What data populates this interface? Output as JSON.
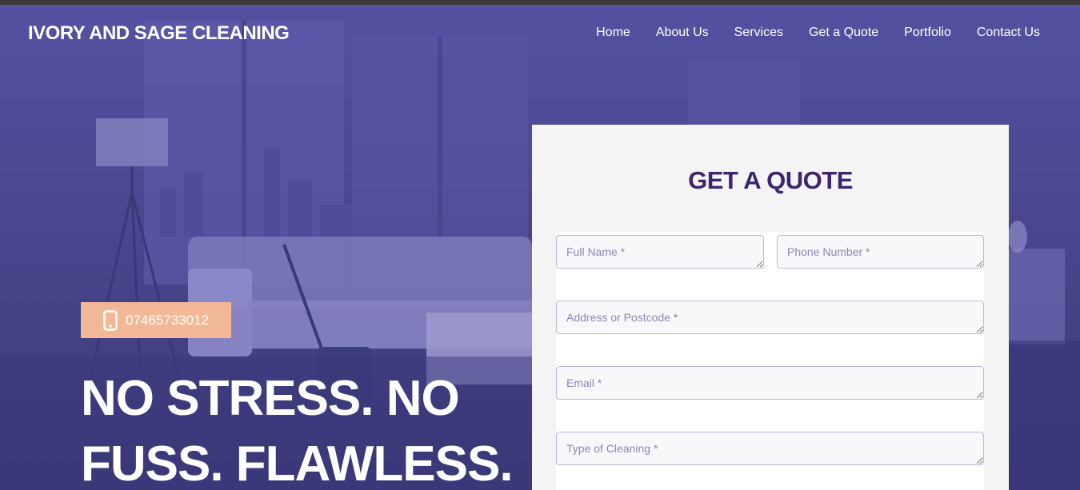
{
  "brand": {
    "name": "IVORY AND SAGE CLEANING"
  },
  "nav": {
    "items": [
      {
        "label": "Home"
      },
      {
        "label": "About Us"
      },
      {
        "label": "Services"
      },
      {
        "label": "Get a Quote"
      },
      {
        "label": "Portfolio"
      },
      {
        "label": "Contact Us"
      }
    ]
  },
  "hero": {
    "phone": "07465733012",
    "headline_line1": "NO STRESS. NO",
    "headline_line2": "FUSS. FLAWLESS."
  },
  "quote_form": {
    "title": "GET A QUOTE",
    "full_name_placeholder": "Full Name *",
    "phone_placeholder": "Phone Number *",
    "address_placeholder": "Address or Postcode *",
    "email_placeholder": "Email *",
    "cleaning_type_placeholder": "Type of Cleaning *"
  },
  "colors": {
    "overlay": "#4a478f",
    "phone_button": "#f2b896",
    "quote_title": "#3f2470",
    "card_bg": "#f4f4f5"
  }
}
